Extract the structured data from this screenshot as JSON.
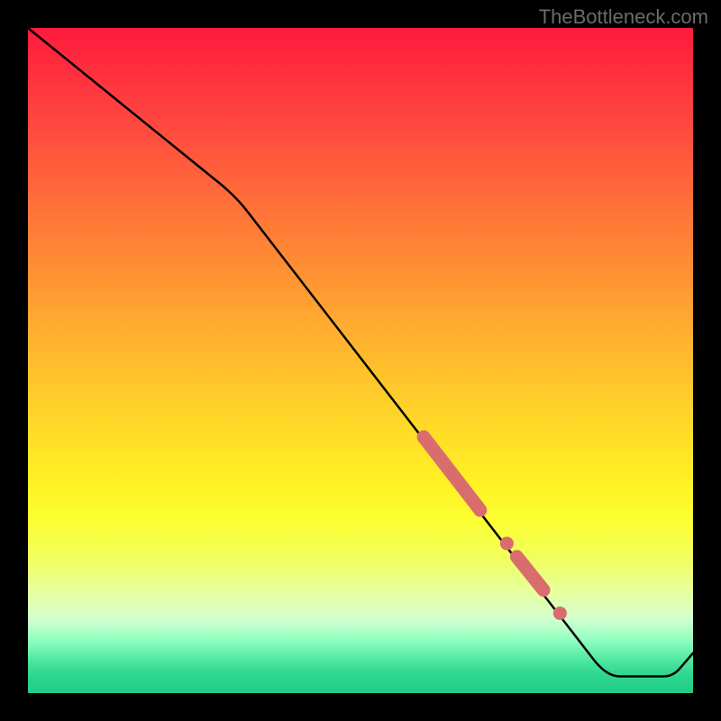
{
  "watermark": "TheBottleneck.com",
  "chart_data": {
    "type": "line",
    "title": "",
    "xlabel": "",
    "ylabel": "",
    "xlim": [
      0,
      100
    ],
    "ylim": [
      0,
      100
    ],
    "series": [
      {
        "name": "curve",
        "points": [
          {
            "x": 0,
            "y": 100
          },
          {
            "x": 31,
            "y": 75
          },
          {
            "x": 87,
            "y": 2.5
          },
          {
            "x": 97,
            "y": 2.5
          },
          {
            "x": 100,
            "y": 6
          }
        ]
      }
    ],
    "markers": [
      {
        "type": "segment",
        "x1": 59.5,
        "y1": 38.5,
        "x2": 68,
        "y2": 27.5
      },
      {
        "type": "dot",
        "x": 72,
        "y": 22.5
      },
      {
        "type": "segment",
        "x1": 73.5,
        "y1": 20.5,
        "x2": 77.5,
        "y2": 15.5
      },
      {
        "type": "dot",
        "x": 80,
        "y": 12
      }
    ],
    "marker_color": "#d96d6d"
  }
}
